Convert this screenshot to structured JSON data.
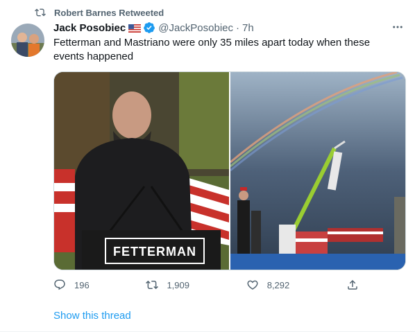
{
  "retweet": {
    "label": "Robert Barnes Retweeted"
  },
  "tweet": {
    "author_name": "Jack Posobiec",
    "author_handle": "@JackPosobiec",
    "separator": "·",
    "time": "7h",
    "text": "Fetterman and Mastriano were only 35 miles apart today when these events happened",
    "podium_sign": "FETTERMAN"
  },
  "actions": {
    "reply_count": "196",
    "retweet_count": "1,909",
    "like_count": "8,292"
  },
  "show_thread": "Show this thread",
  "icons": {
    "retweet": "retweet-icon",
    "verified": "verified-badge-icon",
    "flag": "us-flag-icon",
    "more": "more-icon",
    "reply": "reply-icon",
    "like": "like-icon",
    "share": "share-icon"
  },
  "colors": {
    "accent": "#1d9bf0",
    "muted": "#536471",
    "text": "#0f1419"
  }
}
